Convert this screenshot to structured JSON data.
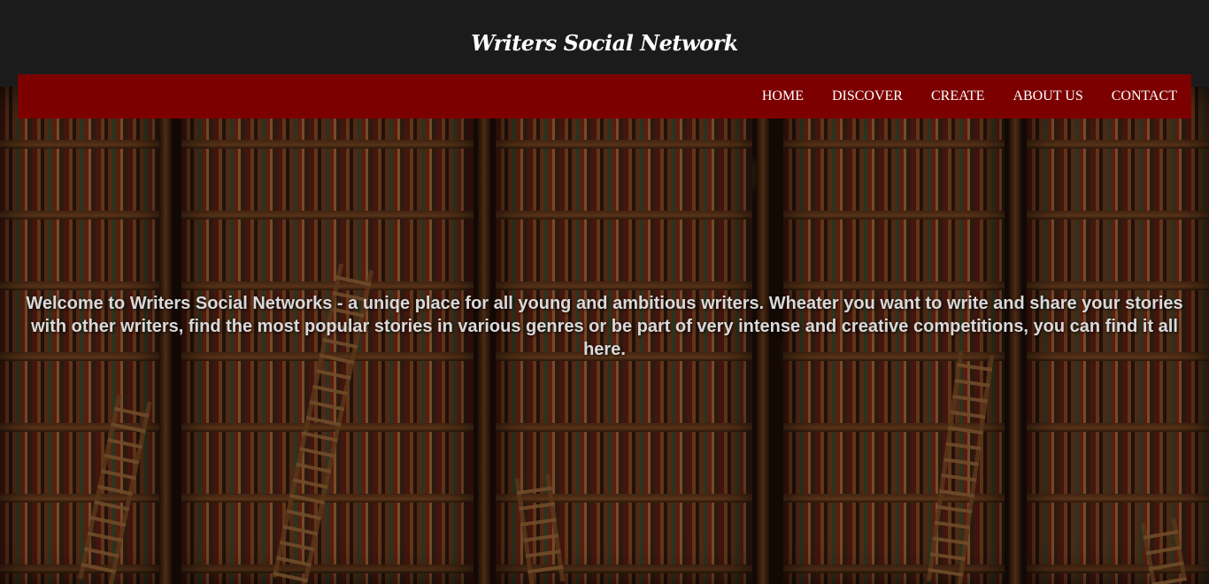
{
  "header": {
    "site_title": "Writers Social Network"
  },
  "nav": {
    "items": [
      {
        "label": "HOME"
      },
      {
        "label": "DISCOVER"
      },
      {
        "label": "CREATE"
      },
      {
        "label": "ABOUT US"
      },
      {
        "label": "CONTACT"
      }
    ]
  },
  "hero": {
    "welcome_text": "Welcome to Writers Social Networks - a uniqe place for all young and ambitious writers. Wheater you want to write and share your stories with other writers, find the most popular stories in various genres or be part of very intense and creative competitions, you can find it all here."
  },
  "colors": {
    "header_bg": "#1b1b1b",
    "nav_bg": "#7d0000",
    "nav_text": "#ffffff",
    "welcome_text": "#d9d9d9"
  }
}
